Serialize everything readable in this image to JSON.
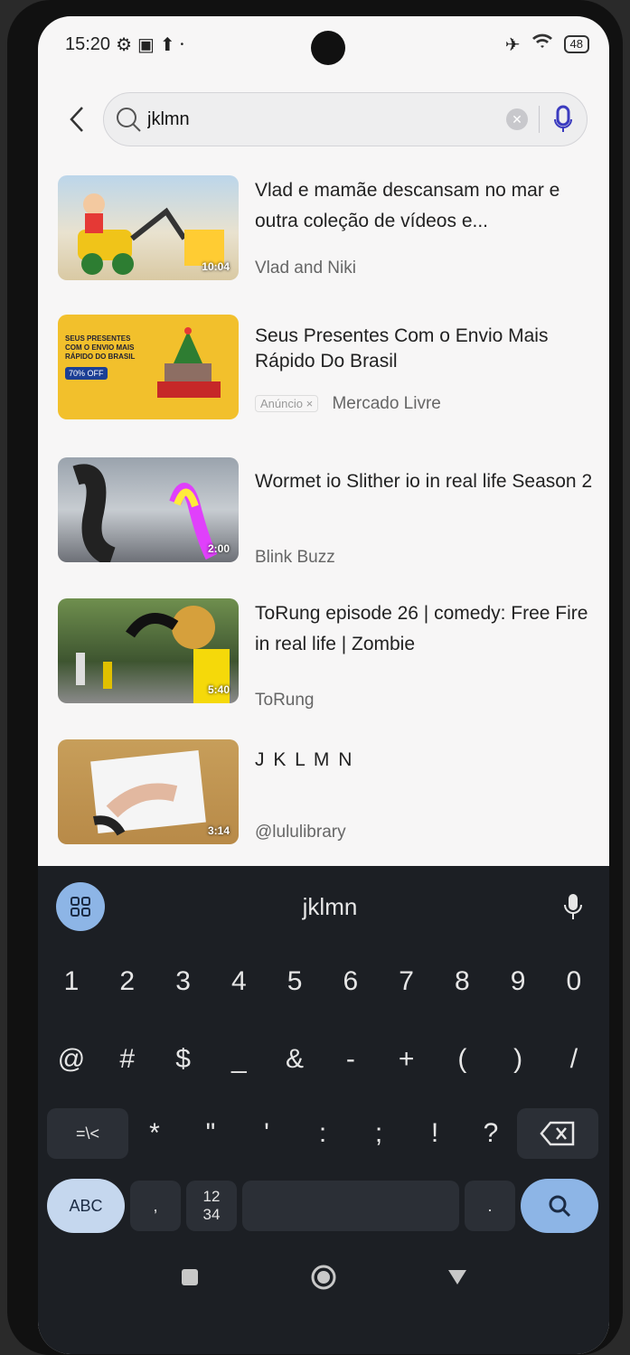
{
  "status_bar": {
    "time": "15:20",
    "battery": "48"
  },
  "search": {
    "value": "jklmn"
  },
  "results": [
    {
      "title": "Vlad e mamãe descansam no mar e outra coleção de vídeos e...",
      "channel": "Vlad and Niki",
      "duration": "10:04",
      "is_ad": false
    },
    {
      "title": "Seus Presentes Com o Envio Mais Rápido Do Brasil",
      "channel": "Mercado Livre",
      "ad_label": "Anúncio ×",
      "thumb_text": "SEUS PRESENTES COM O ENVIO MAIS RÁPIDO DO BRASIL",
      "thumb_badge": "70% OFF",
      "is_ad": true
    },
    {
      "title": "Wormet io Slither io in real life Season 2",
      "channel": "Blink Buzz",
      "duration": "2:00",
      "is_ad": false
    },
    {
      "title": "ToRung episode 26 | comedy: Free Fire in real life | Zombie",
      "channel": "ToRung",
      "duration": "5:40",
      "is_ad": false
    },
    {
      "title": "J K L M N",
      "channel": "@lululibrary",
      "duration": "3:14",
      "is_ad": false
    }
  ],
  "keyboard": {
    "suggestion": "jklmn",
    "row_numbers": [
      "1",
      "2",
      "3",
      "4",
      "5",
      "6",
      "7",
      "8",
      "9",
      "0"
    ],
    "row_symbols1": [
      "@",
      "#",
      "$",
      "_",
      "&",
      "-",
      "+",
      "(",
      ")",
      "/"
    ],
    "row_symbols2": [
      "*",
      "\"",
      "'",
      ":",
      ";",
      "!",
      "?"
    ],
    "shift_key": "=\\<",
    "abc_key": "ABC",
    "comma_key": ",",
    "numpad_key_top": "12",
    "numpad_key_bottom": "34",
    "period_key": "."
  },
  "colors": {
    "screen_bg": "#f7f6f6",
    "keyboard_bg": "#1c1f24",
    "accent_blue": "#8db5e6"
  }
}
